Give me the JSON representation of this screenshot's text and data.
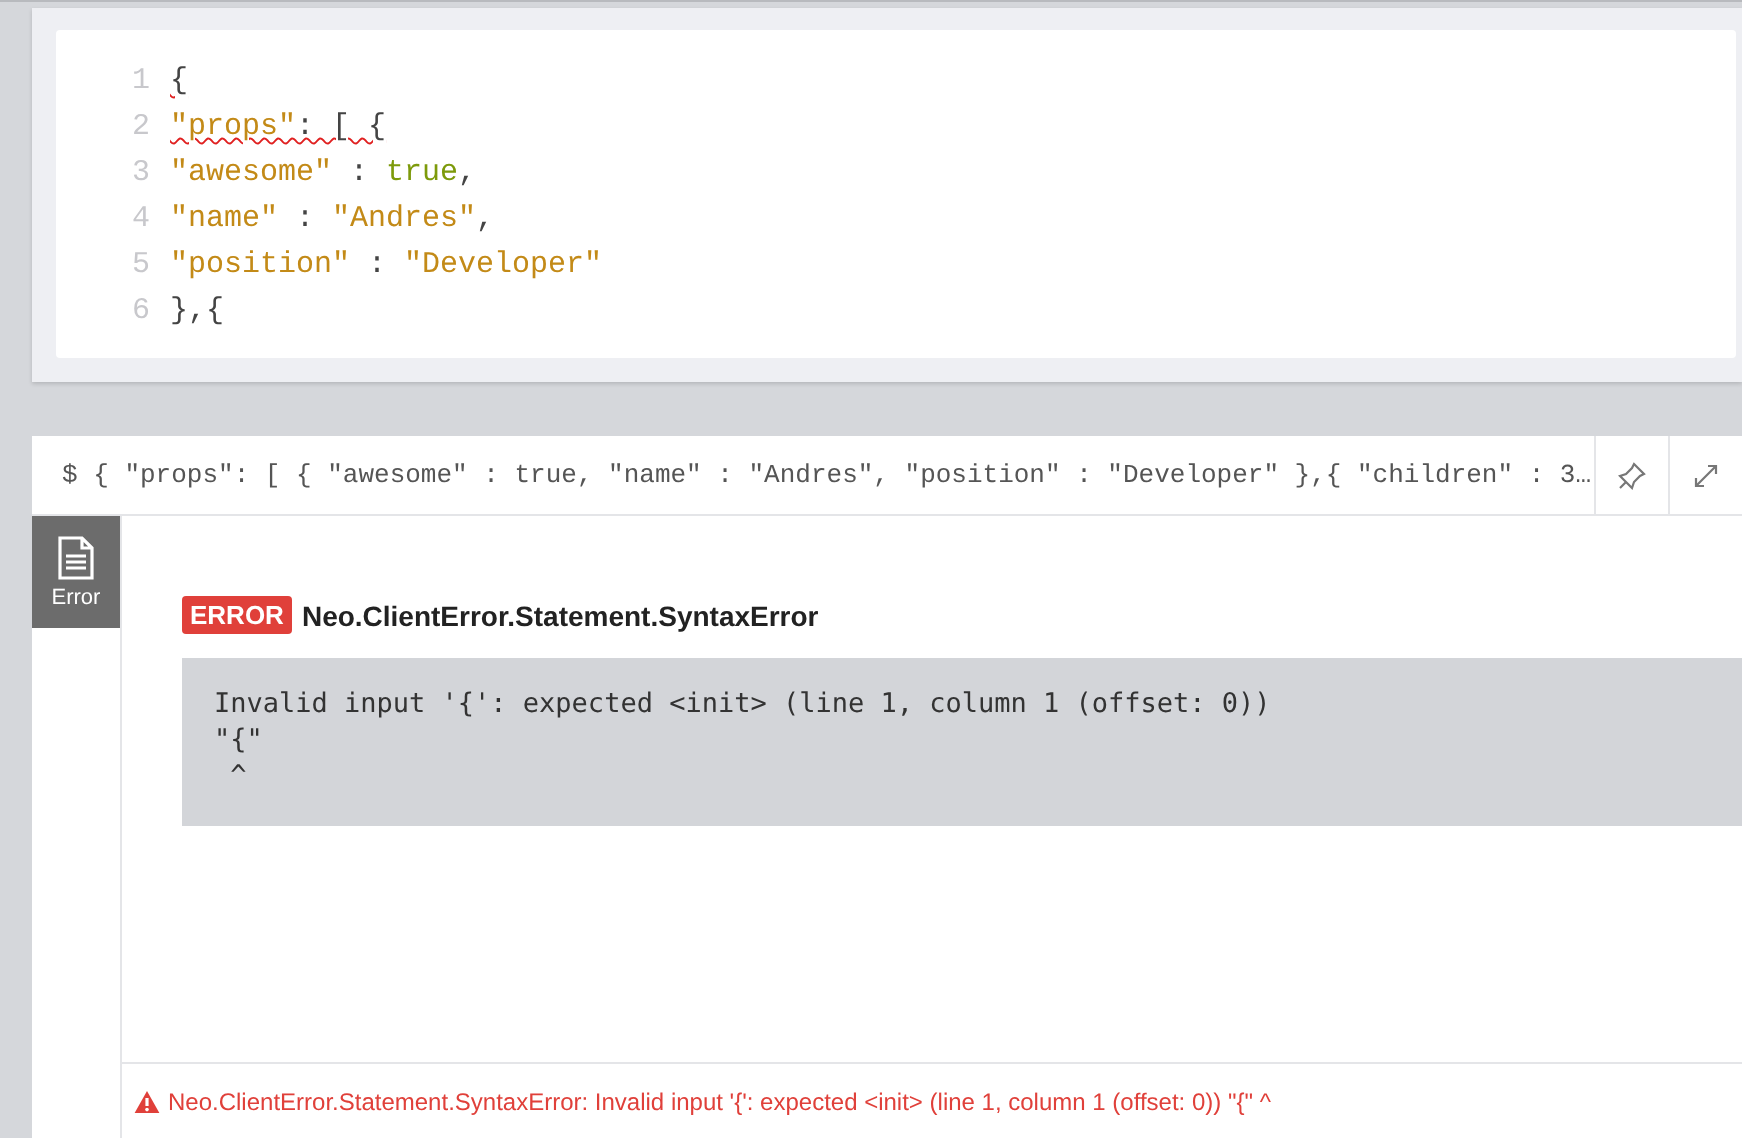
{
  "editor": {
    "lines": [
      {
        "number": "1",
        "flagged": true,
        "tokens": [
          {
            "kind": "punct",
            "text": "{"
          }
        ]
      },
      {
        "number": "2",
        "flagged": true,
        "tokens": [
          {
            "kind": "string",
            "text": "\"props\""
          },
          {
            "kind": "punct",
            "text": ": [ {"
          }
        ]
      },
      {
        "number": "3",
        "flagged": false,
        "tokens": [
          {
            "kind": "string",
            "text": "\"awesome\""
          },
          {
            "kind": "punct",
            "text": " : "
          },
          {
            "kind": "bool",
            "text": "true"
          },
          {
            "kind": "punct",
            "text": ","
          }
        ]
      },
      {
        "number": "4",
        "flagged": false,
        "tokens": [
          {
            "kind": "string",
            "text": "\"name\""
          },
          {
            "kind": "punct",
            "text": " : "
          },
          {
            "kind": "string",
            "text": "\"Andres\""
          },
          {
            "kind": "punct",
            "text": ","
          }
        ]
      },
      {
        "number": "5",
        "flagged": false,
        "tokens": [
          {
            "kind": "string",
            "text": "\"position\""
          },
          {
            "kind": "punct",
            "text": " : "
          },
          {
            "kind": "string",
            "text": "\"Developer\""
          }
        ]
      },
      {
        "number": "6",
        "flagged": false,
        "tokens": [
          {
            "kind": "punct",
            "text": "},{"
          }
        ]
      }
    ]
  },
  "result": {
    "query": "$ { \"props\": [ { \"awesome\" : true, \"name\" : \"Andres\", \"position\" : \"Developer\" },{ \"children\" : 3…",
    "tabs": [
      {
        "label": "Error",
        "selected": true
      }
    ],
    "badge": "ERROR",
    "title": "Neo.ClientError.Statement.SyntaxError",
    "message_lines": [
      "Invalid input '{': expected <init> (line 1, column 1 (offset: 0))",
      "\"{\"",
      " ^"
    ],
    "status": "Neo.ClientError.Statement.SyntaxError: Invalid input '{': expected <init> (line 1, column 1 (offset: 0)) \"{\" ^"
  }
}
